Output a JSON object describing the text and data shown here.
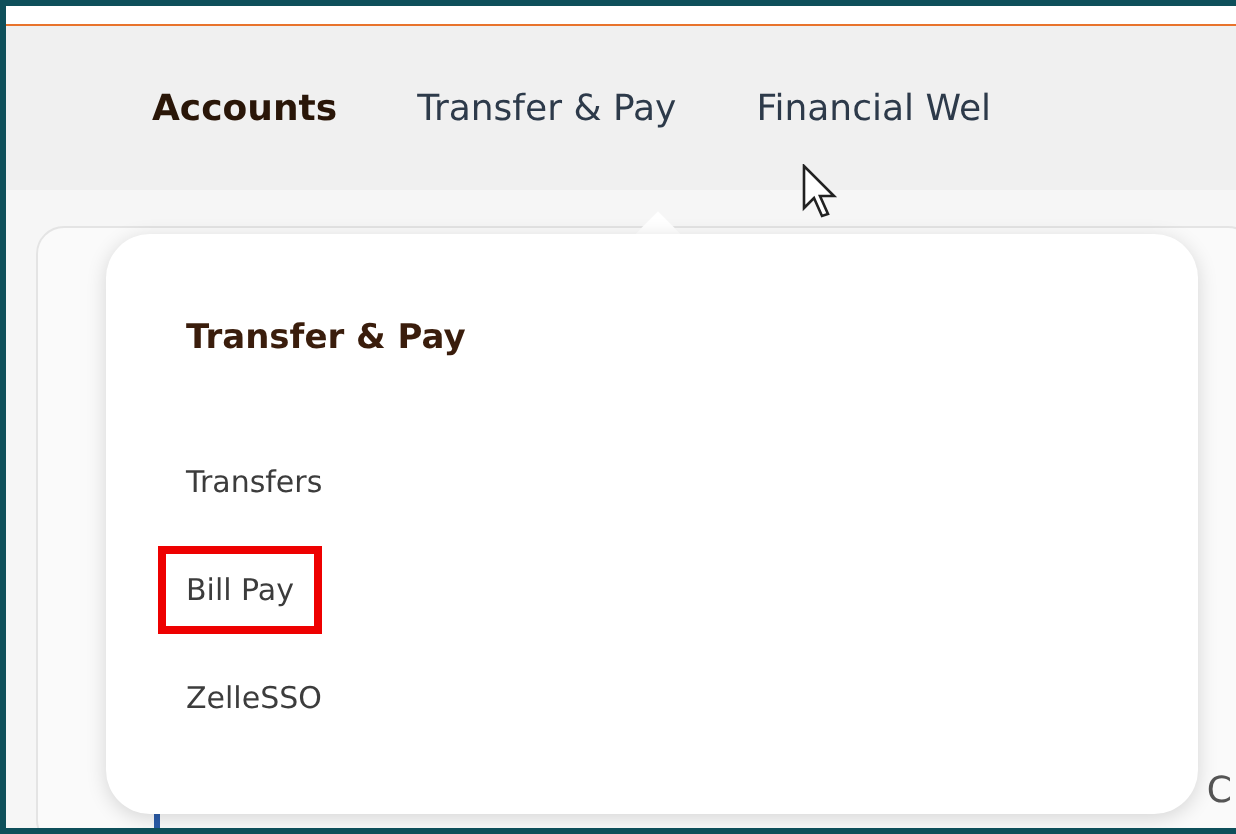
{
  "nav": {
    "items": [
      {
        "label": "Accounts",
        "selected": true
      },
      {
        "label": "Transfer & Pay",
        "selected": false
      },
      {
        "label": "Financial Wel",
        "selected": false
      }
    ]
  },
  "menu": {
    "title": "Transfer & Pay",
    "items": [
      {
        "label": "Transfers",
        "highlighted": false
      },
      {
        "label": "Bill Pay",
        "highlighted": true
      },
      {
        "label": "ZelleSSO",
        "highlighted": false
      }
    ]
  },
  "background_text": "C"
}
